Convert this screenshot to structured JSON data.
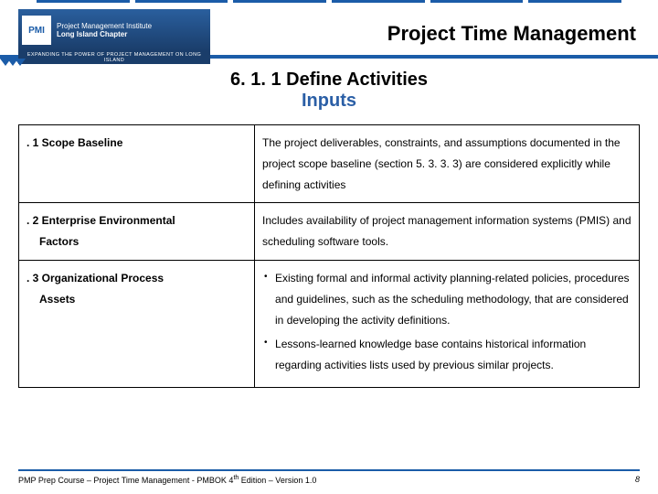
{
  "header": {
    "logo_top": "Project Management Institute",
    "logo_bottom": "Long Island Chapter",
    "tagline": "EXPANDING THE POWER OF PROJECT MANAGEMENT ON LONG ISLAND",
    "title": "Project Time Management"
  },
  "section": {
    "title": "6. 1. 1 Define Activities",
    "subtitle": "Inputs"
  },
  "rows": [
    {
      "label": ". 1  Scope Baseline",
      "desc": "The project deliverables, constraints, and assumptions documented in the project scope baseline (section 5. 3. 3. 3) are considered explicitly while defining activities"
    },
    {
      "label": ". 2 Enterprise Environmental",
      "label2": "Factors",
      "desc": "Includes availability of project management information systems (PMIS) and scheduling software tools."
    },
    {
      "label": ". 3 Organizational Process",
      "label2": "Assets",
      "bullets": [
        "Existing formal and informal activity planning-related policies, procedures and guidelines, such as the scheduling methodology, that are considered in developing the activity definitions.",
        "Lessons-learned knowledge base contains historical information regarding activities lists used by previous similar projects."
      ]
    }
  ],
  "footer": {
    "text": "PMP Prep Course – Project Time Management - PMBOK 4th Edition – Version 1.0",
    "page": "8"
  }
}
